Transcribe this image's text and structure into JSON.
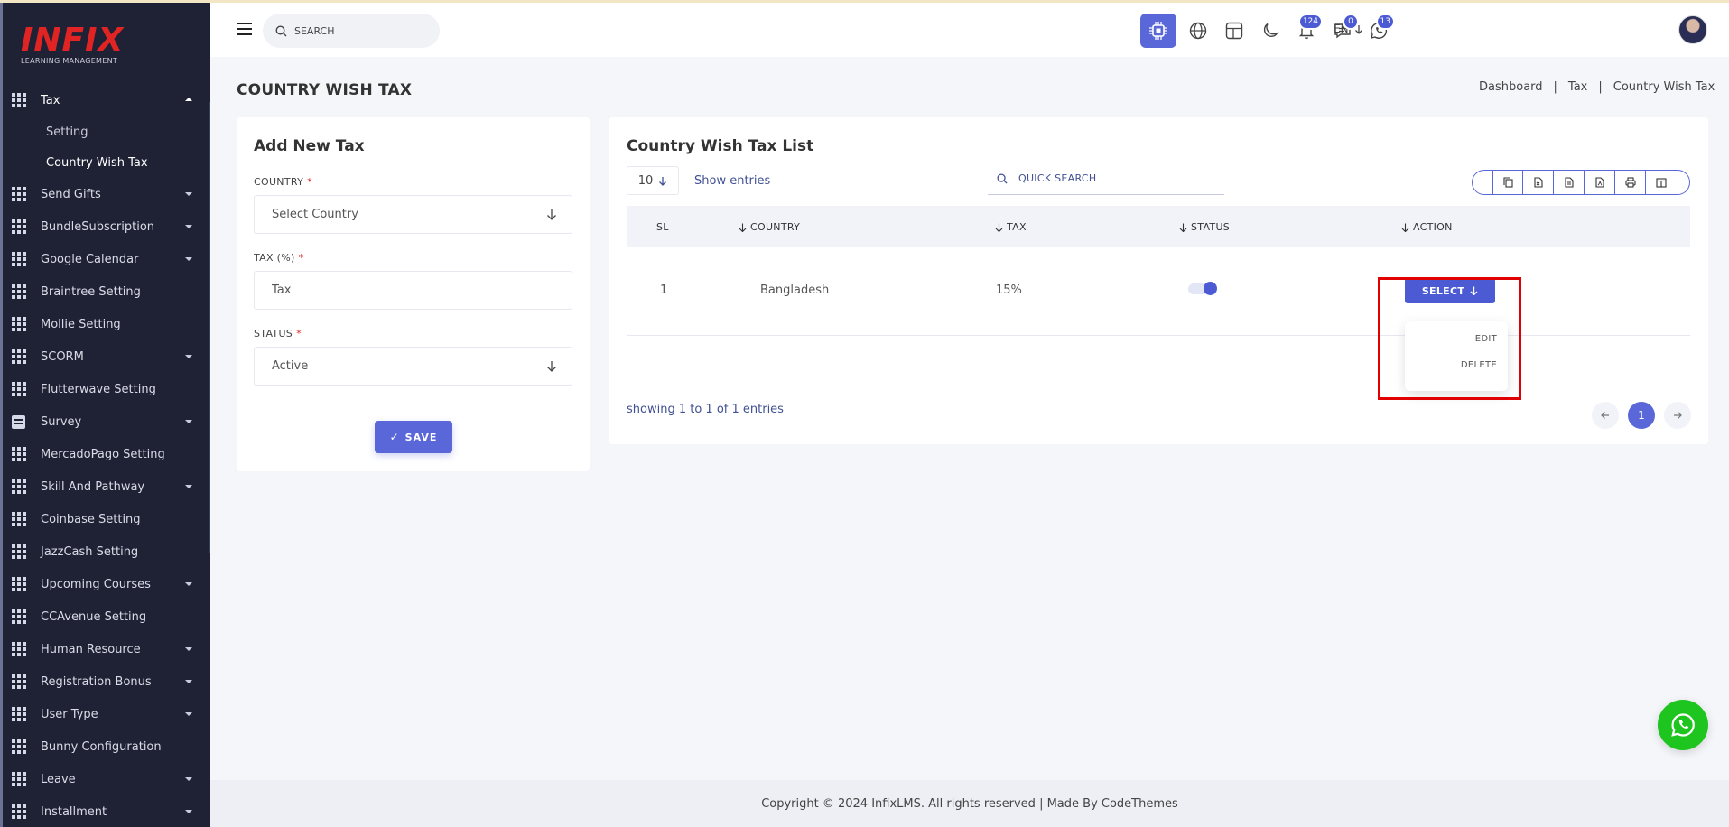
{
  "brand": {
    "logo_text": "INFIX",
    "logo_sub": "LEARNING MANAGEMENT",
    "logo_color": "#e02424"
  },
  "sidebar": {
    "items": [
      {
        "label": "Tax",
        "icon": "grid-icon",
        "expanded": true,
        "children": [
          {
            "label": "Setting"
          },
          {
            "label": "Country Wish Tax",
            "current": true
          }
        ]
      },
      {
        "label": "Send Gifts",
        "icon": "grid-icon",
        "caret": true
      },
      {
        "label": "BundleSubscription",
        "icon": "grid-icon",
        "caret": true
      },
      {
        "label": "Google Calendar",
        "icon": "grid-icon",
        "caret": true
      },
      {
        "label": "Braintree Setting",
        "icon": "grid-icon",
        "caret": false
      },
      {
        "label": "Mollie Setting",
        "icon": "grid-icon",
        "caret": false
      },
      {
        "label": "SCORM",
        "icon": "grid-icon",
        "caret": true
      },
      {
        "label": "Flutterwave Setting",
        "icon": "grid-icon",
        "caret": false
      },
      {
        "label": "Survey",
        "icon": "survey-icon",
        "caret": true
      },
      {
        "label": "MercadoPago Setting",
        "icon": "grid-icon",
        "caret": false
      },
      {
        "label": "Skill And Pathway",
        "icon": "grid-icon",
        "caret": true
      },
      {
        "label": "Coinbase Setting",
        "icon": "grid-icon",
        "caret": false
      },
      {
        "label": "JazzCash Setting",
        "icon": "grid-icon",
        "caret": false
      },
      {
        "label": "Upcoming Courses",
        "icon": "grid-icon",
        "caret": true
      },
      {
        "label": "CCAvenue Setting",
        "icon": "grid-icon",
        "caret": false
      },
      {
        "label": "Human Resource",
        "icon": "grid-icon",
        "caret": true
      },
      {
        "label": "Registration Bonus",
        "icon": "grid-icon",
        "caret": true
      },
      {
        "label": "User Type",
        "icon": "grid-icon",
        "caret": true
      },
      {
        "label": "Bunny Configuration",
        "icon": "grid-icon",
        "caret": false
      },
      {
        "label": "Leave",
        "icon": "grid-icon",
        "caret": true
      },
      {
        "label": "Installment",
        "icon": "grid-icon",
        "caret": true
      }
    ]
  },
  "header": {
    "search_placeholder": "SEARCH",
    "language": "EN",
    "notifications_count": "124",
    "messages_count": "0",
    "whatsapp_count": "13"
  },
  "page": {
    "title": "COUNTRY WISH TAX",
    "breadcrumb": [
      "Dashboard",
      "Tax",
      "Country Wish Tax"
    ]
  },
  "add_form": {
    "title": "Add New Tax",
    "country_label": "COUNTRY",
    "country_value": "Select Country",
    "tax_label": "TAX (%)",
    "tax_placeholder": "Tax",
    "status_label": "STATUS",
    "status_value": "Active",
    "required_mark": "*",
    "save_label": "SAVE"
  },
  "list": {
    "title": "Country Wish Tax List",
    "page_size": "10",
    "show_entries": "Show entries",
    "quick_search_placeholder": "QUICK SEARCH",
    "columns": [
      "SL",
      "COUNTRY",
      "TAX",
      "STATUS",
      "ACTION"
    ],
    "rows": [
      {
        "sl": "1",
        "country": "Bangladesh",
        "tax": "15%",
        "status_on": true
      }
    ],
    "select_label": "SELECT",
    "dropdown": [
      "EDIT",
      "DELETE"
    ],
    "showing": "showing 1 to 1 of 1 entries",
    "current_page": "1"
  },
  "footer": {
    "text": "Copyright © 2024 InfixLMS. All rights reserved | Made By CodeThemes"
  },
  "colors": {
    "accent": "#5a67d8",
    "sidebar_bg": "#1f2235",
    "highlight": "#e00000",
    "whatsapp": "#1ec51e"
  }
}
